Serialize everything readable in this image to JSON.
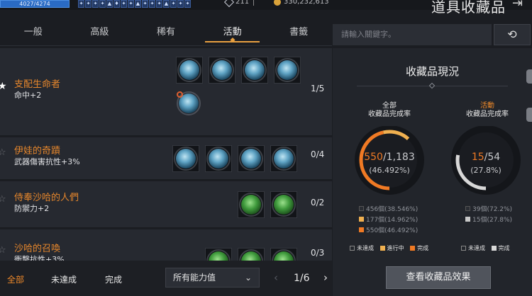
{
  "status": {
    "hp": "4027/4274",
    "crystals": "211",
    "gold": "330,232,613"
  },
  "buff_icons": [
    "✦",
    "✦",
    "✦",
    "✦",
    "▲",
    "♦",
    "✦",
    "✦",
    "▲",
    "✦",
    "✦",
    "✦",
    "▲",
    "✦",
    "✦",
    "✦"
  ],
  "page_title": "道具收藏品",
  "exit_icon": "exit-icon",
  "tabs": [
    {
      "label": "一般",
      "selected": false
    },
    {
      "label": "高級",
      "selected": false
    },
    {
      "label": "稀有",
      "selected": false
    },
    {
      "label": "活動",
      "selected": true
    },
    {
      "label": "書籤",
      "selected": false
    }
  ],
  "collections": [
    {
      "name": "支配生命者",
      "stat": "命中+2",
      "progress": "1/5",
      "bookmarked": true,
      "item_type": "blue",
      "items": 5,
      "highlight_item": 5
    },
    {
      "name": "伊娃的奇蹟",
      "stat": "武器傷害抗性+3%",
      "progress": "0/4",
      "bookmarked": false,
      "item_type": "blue",
      "items": 4,
      "highlight_item": 0
    },
    {
      "name": "侍奉沙哈的人們",
      "stat": "防禦力+2",
      "progress": "0/2",
      "bookmarked": false,
      "item_type": "green",
      "items": 2,
      "highlight_item": 0
    },
    {
      "name": "沙哈的召喚",
      "stat": "衝擊抗性+3%",
      "progress": "0/3",
      "bookmarked": false,
      "item_type": "green",
      "items": 3,
      "highlight_item": 0
    }
  ],
  "filters": {
    "all": "全部",
    "incomplete": "未達成",
    "complete": "完成",
    "selected": "all"
  },
  "ability_select": {
    "value": "所有能力值"
  },
  "pagination": {
    "current": "1/6",
    "prev": "‹",
    "next": "›"
  },
  "search": {
    "placeholder": "請輸入關鍵字。",
    "refresh_icon": "refresh-icon"
  },
  "summary": {
    "title": "收藏品現況",
    "total": {
      "label_top": "全部",
      "label_bottom": "收藏品完成率",
      "completed": "550",
      "total": "1,183",
      "percent": "(46.492%)",
      "completed_fraction": 0.46492,
      "in_progress_fraction": 0.14962
    },
    "event": {
      "label_top": "活動",
      "label_bottom": "收藏品完成率",
      "completed": "15",
      "total": "54",
      "percent": "(27.8%)",
      "completed_fraction": 0.278
    },
    "total_legend": [
      "456個(38.546%)",
      "177個(14.962%)",
      "550個(46.492%)"
    ],
    "event_legend": [
      "39個(72.2%)",
      "15個(27.8%)"
    ],
    "total_keys": [
      "未達成",
      "進行中",
      "完成"
    ],
    "event_keys": [
      "未達成",
      "完成"
    ],
    "colors": {
      "complete": "#f07a24",
      "in_progress": "#f0b050",
      "incomplete": "#2a2d33",
      "event_complete": "#d8d8d8"
    }
  },
  "effect_button": "查看收藏品效果"
}
